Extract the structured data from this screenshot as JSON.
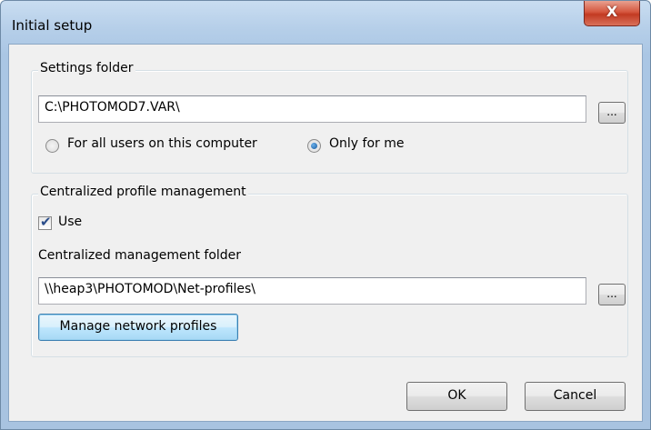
{
  "window": {
    "title": "Initial setup",
    "close_glyph": "X"
  },
  "settings_folder": {
    "group_label": "Settings folder",
    "path_value": "C:\\PHOTOMOD7.VAR\\",
    "browse_label": "...",
    "radio_all_users_label": "For all users on this computer",
    "radio_only_me_label": "Only for me",
    "selected": "Only for me"
  },
  "centralized": {
    "group_label": "Centralized profile management",
    "use_label": "Use",
    "use_checked": true,
    "folder_label": "Centralized management folder",
    "folder_value": "\\\\heap3\\PHOTOMOD\\Net-profiles\\",
    "browse_label": "...",
    "manage_button_label": "Manage network profiles"
  },
  "footer": {
    "ok_label": "OK",
    "cancel_label": "Cancel"
  },
  "icons": {
    "close": "close-icon",
    "check": "check-icon",
    "radio_dot": "radio-dot-icon"
  }
}
